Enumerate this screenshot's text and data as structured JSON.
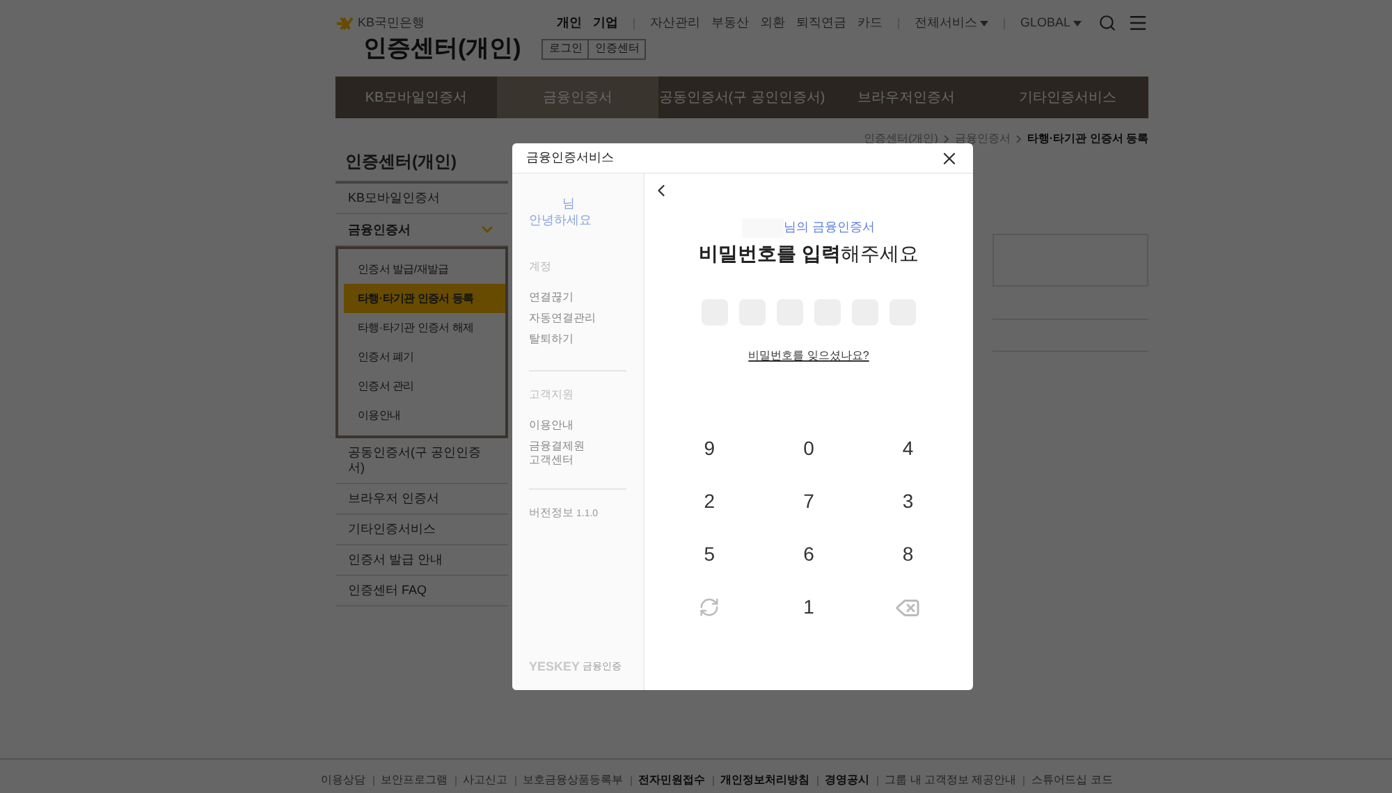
{
  "header": {
    "logo": "KB국민은행",
    "nav": [
      {
        "label": "개인",
        "bold": true,
        "dropdown": false,
        "separator_before": false
      },
      {
        "label": "기업",
        "bold": true,
        "dropdown": false,
        "separator_before": false
      },
      {
        "label": "자산관리",
        "bold": false,
        "dropdown": false,
        "separator_before": true
      },
      {
        "label": "부동산",
        "bold": false,
        "dropdown": false,
        "separator_before": false
      },
      {
        "label": "외환",
        "bold": false,
        "dropdown": false,
        "separator_before": false
      },
      {
        "label": "퇴직연금",
        "bold": false,
        "dropdown": false,
        "separator_before": false
      },
      {
        "label": "카드",
        "bold": false,
        "dropdown": false,
        "separator_before": false
      },
      {
        "label": "전체서비스",
        "bold": false,
        "dropdown": true,
        "separator_before": true
      },
      {
        "label": "GLOBAL",
        "bold": false,
        "dropdown": true,
        "separator_before": true
      }
    ],
    "title": "인증센터(개인)",
    "buttons": [
      "로그인",
      "인증센터"
    ]
  },
  "tabs": [
    {
      "label": "KB모바일인증서",
      "selected": false
    },
    {
      "label": "금융인증서",
      "selected": true
    },
    {
      "label": "공동인증서(구 공인인증서)",
      "selected": false
    },
    {
      "label": "브라우저인증서",
      "selected": false
    },
    {
      "label": "기타인증서비스",
      "selected": false
    }
  ],
  "breadcrumb": [
    "인증센터(개인)",
    "금융인증서",
    "타행·타기관 인증서 등록"
  ],
  "sidebar": {
    "title": "인증센터(개인)",
    "items": [
      {
        "label": "KB모바일인증서",
        "expanded": false
      },
      {
        "label": "금융인증서",
        "expanded": true,
        "children": [
          {
            "label": "인증서 발급/재발급",
            "selected": false
          },
          {
            "label": "타행·타기관 인증서 등록",
            "selected": true
          },
          {
            "label": "타행·타기관 인증서 해제",
            "selected": false
          },
          {
            "label": "인증서 폐기",
            "selected": false
          },
          {
            "label": "인증서 관리",
            "selected": false
          },
          {
            "label": "이용안내",
            "selected": false
          }
        ]
      },
      {
        "label": "공동인증서(구 공인인증서)",
        "expanded": false
      },
      {
        "label": "브라우저 인증서",
        "expanded": false
      },
      {
        "label": "기타인증서비스",
        "expanded": false
      },
      {
        "label": "인증서 발급 안내",
        "expanded": false
      },
      {
        "label": "인증센터 FAQ",
        "expanded": false
      }
    ]
  },
  "footer": [
    {
      "label": "이용상담",
      "bold": false
    },
    {
      "label": "보안프로그램",
      "bold": false
    },
    {
      "label": "사고신고",
      "bold": false
    },
    {
      "label": "보호금융상품등록부",
      "bold": false
    },
    {
      "label": "전자민원접수",
      "bold": true
    },
    {
      "label": "개인정보처리방침",
      "bold": true
    },
    {
      "label": "경영공시",
      "bold": true
    },
    {
      "label": "그룹 내 고객정보 제공안내",
      "bold": false
    },
    {
      "label": "스튜어드십 코드",
      "bold": false
    }
  ],
  "dialog": {
    "title": "금융인증서비스",
    "side": {
      "greeting_name": "님",
      "greeting": "안녕하세요",
      "sections": [
        {
          "heading": "계정",
          "links": [
            "연결끊기",
            "자동연결관리",
            "탈퇴하기"
          ]
        },
        {
          "heading": "고객지원",
          "links": [
            "이용안내",
            "금융결제원\n고객센터"
          ]
        }
      ],
      "version_label": "버전정보",
      "version": "1.1.0",
      "brand": "YESKEY",
      "brand_sub": "금융인증"
    },
    "owner_suffix": "님의 금융인증서",
    "prompt": "**비밀번호를 입력**해주세요",
    "pin": [
      {
        "filled": false
      },
      {
        "filled": false
      },
      {
        "filled": false
      },
      {
        "filled": false
      },
      {
        "filled": false
      },
      {
        "filled": false
      }
    ],
    "forgot_link": "비밀번호를 잊으셨나요?",
    "keypad": [
      {
        "kind": "digit",
        "label": "9"
      },
      {
        "kind": "digit",
        "label": "0"
      },
      {
        "kind": "digit",
        "label": "4"
      },
      {
        "kind": "digit",
        "label": "2"
      },
      {
        "kind": "digit",
        "label": "7"
      },
      {
        "kind": "digit",
        "label": "3"
      },
      {
        "kind": "digit",
        "label": "5"
      },
      {
        "kind": "digit",
        "label": "6"
      },
      {
        "kind": "digit",
        "label": "8"
      },
      {
        "kind": "refresh"
      },
      {
        "kind": "digit",
        "label": "1"
      },
      {
        "kind": "backspace"
      }
    ]
  }
}
